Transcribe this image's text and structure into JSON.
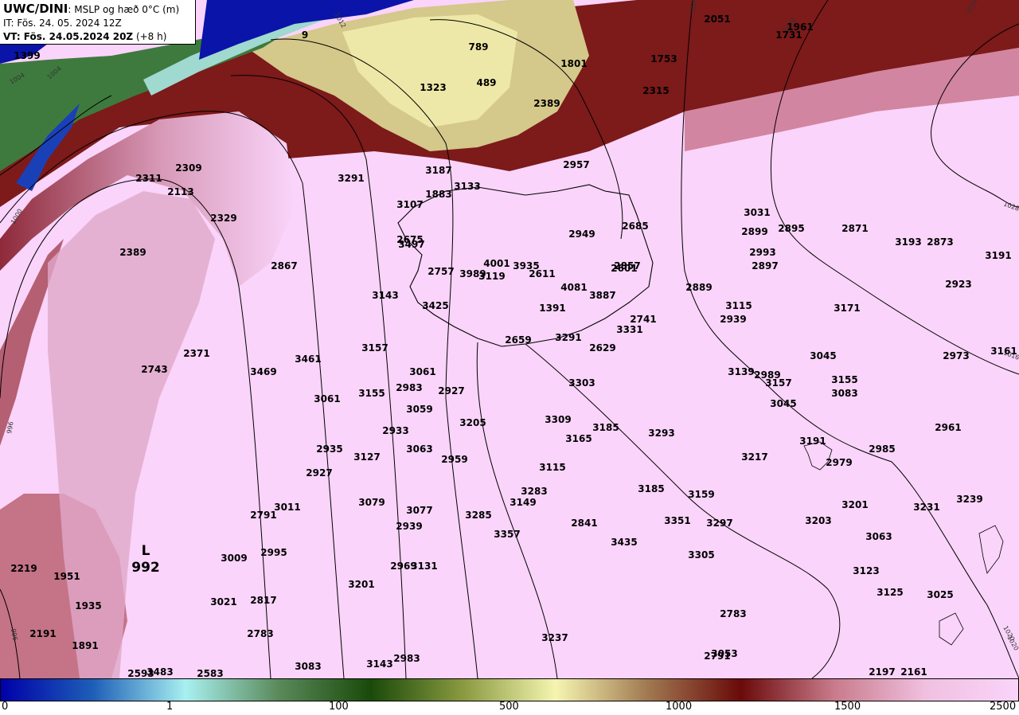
{
  "header": {
    "model": "UWC/DINI",
    "field": ": MSLP og hæð 0°C (m)",
    "initial_time": "IT: Fös. 24. 05. 2024 12Z",
    "valid_time": "VT: Fös. 24.05.2024 20Z",
    "lead": " (+8 h)"
  },
  "colorbar": {
    "ticks": [
      "0",
      "1",
      "100",
      "500",
      "1000",
      "1500",
      "2500"
    ],
    "colors": [
      "#0000a8",
      "#1e5fb8",
      "#a8f0f0",
      "#5a8a5a",
      "#1a4a0a",
      "#8a9a40",
      "#f5f5b0",
      "#a07850",
      "#6a0a0a",
      "#c87a8a",
      "#f0c0e0",
      "#fad4fa"
    ]
  },
  "low_center": {
    "letter": "L",
    "value": "992"
  },
  "isobar_labels": [
    "1004",
    "1004",
    "1000",
    "996",
    "996",
    "1012",
    "1020",
    "1024",
    "1028",
    "1024",
    "1020",
    "1016",
    "1020"
  ],
  "height_labels": [
    "2051",
    "1961",
    "1731",
    "789",
    "1801",
    "1753",
    "1323",
    "489",
    "2315",
    "2389",
    "9",
    "1399",
    "2311",
    "2309",
    "2113",
    "3291",
    "3187",
    "3133",
    "1883",
    "3107",
    "2957",
    "3031",
    "2899",
    "2895",
    "2871",
    "3193",
    "2873",
    "3191",
    "2329",
    "2389",
    "2867",
    "2949",
    "2685",
    "2675",
    "3497",
    "2757",
    "3989",
    "4001",
    "3119",
    "3935",
    "2611",
    "2857",
    "2601",
    "2993",
    "2897",
    "2889",
    "2923",
    "4081",
    "3887",
    "1391",
    "3143",
    "3425",
    "3115",
    "2939",
    "3171",
    "2741",
    "3331",
    "3291",
    "2659",
    "2629",
    "3157",
    "2371",
    "2743",
    "3461",
    "3469",
    "3061",
    "2983",
    "3155",
    "2927",
    "3061",
    "3045",
    "3139",
    "2989",
    "3157",
    "3155",
    "3083",
    "2973",
    "3161",
    "3303",
    "3059",
    "3309",
    "3185",
    "3165",
    "3205",
    "2933",
    "3293",
    "3045",
    "3191",
    "3063",
    "2935",
    "3127",
    "2959",
    "3217",
    "3115",
    "2979",
    "2985",
    "2961",
    "2927",
    "3283",
    "3079",
    "3149",
    "3185",
    "3159",
    "3011",
    "2791",
    "3077",
    "3285",
    "3201",
    "3231",
    "3239",
    "2939",
    "3357",
    "2841",
    "3351",
    "3297",
    "2995",
    "3435",
    "3203",
    "3009",
    "2969",
    "3131",
    "3305",
    "3063",
    "2219",
    "1951",
    "3021",
    "2817",
    "3201",
    "3123",
    "1935",
    "3125",
    "3025",
    "2783",
    "2783",
    "2191",
    "1891",
    "3237",
    "3083",
    "3143",
    "2983",
    "2791",
    "3053",
    "2593",
    "3483",
    "2583",
    "2197",
    "2161",
    "1801"
  ]
}
